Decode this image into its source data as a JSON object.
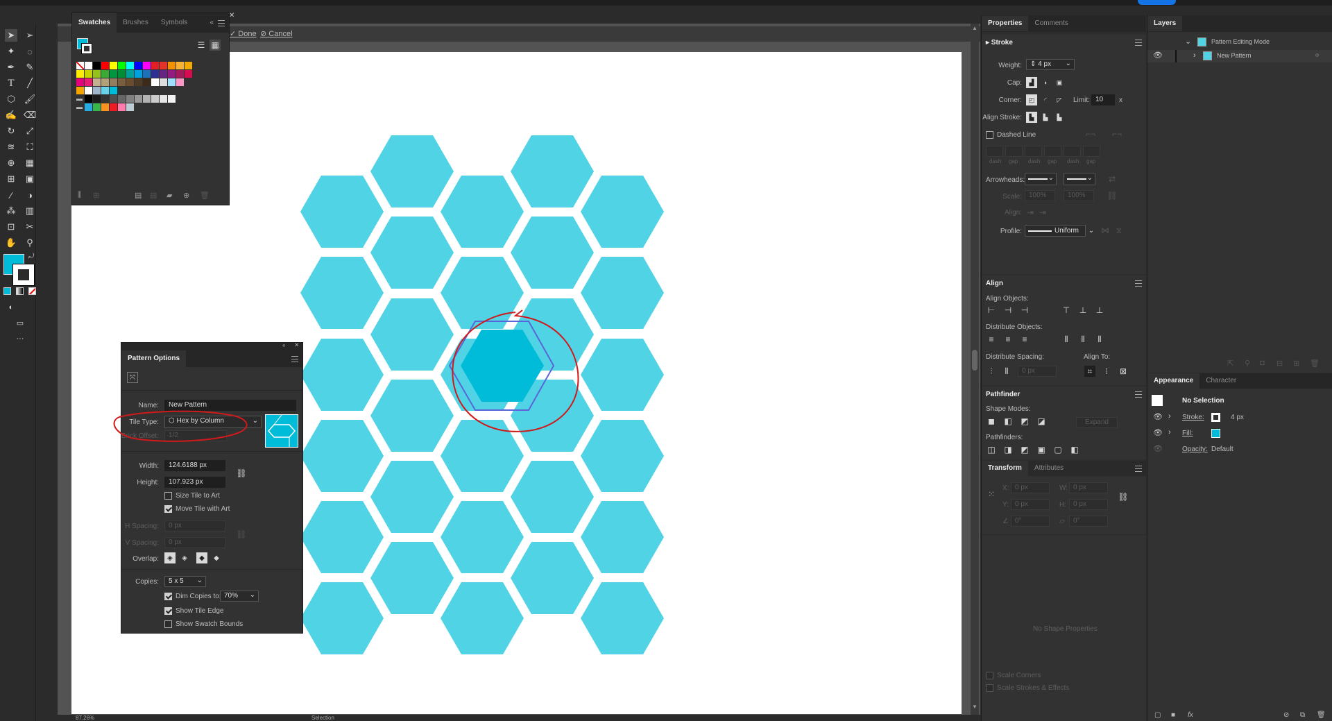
{
  "edit_bar": {
    "done": "Done",
    "cancel": "Cancel"
  },
  "swatches_panel": {
    "tabs": [
      "Swatches",
      "Brushes",
      "Symbols"
    ]
  },
  "pattern_options": {
    "title": "Pattern Options",
    "name_label": "Name:",
    "name_value": "New Pattern",
    "tile_type_label": "Tile Type:",
    "tile_type_value": "Hex by Column",
    "brick_offset_label": "Brick Offset:",
    "brick_offset_value": "1/2",
    "width_label": "Width:",
    "width_value": "124.6188 px",
    "height_label": "Height:",
    "height_value": "107.923 px",
    "size_tile_label": "Size Tile to Art",
    "move_tile_label": "Move Tile with Art",
    "h_spacing_label": "H Spacing:",
    "h_spacing_value": "0 px",
    "v_spacing_label": "V Spacing:",
    "v_spacing_value": "0 px",
    "overlap_label": "Overlap:",
    "copies_label": "Copies:",
    "copies_value": "5 x 5",
    "dim_copies_label": "Dim Copies to:",
    "dim_copies_value": "70%",
    "show_tile_edge_label": "Show Tile Edge",
    "show_swatch_bounds_label": "Show Swatch Bounds",
    "size_tile_checked": false,
    "move_tile_checked": true,
    "dim_copies_checked": true,
    "show_tile_edge_checked": true,
    "show_swatch_bounds_checked": false
  },
  "properties": {
    "tabs": [
      "Properties",
      "Comments"
    ],
    "stroke": {
      "title": "Stroke",
      "weight_label": "Weight:",
      "weight_value": "4 px",
      "cap_label": "Cap:",
      "corner_label": "Corner:",
      "limit_label": "Limit:",
      "limit_value": "10",
      "limit_unit": "x",
      "align_stroke_label": "Align Stroke:",
      "dashed_line_label": "Dashed Line",
      "dash_labels": [
        "dash",
        "gap",
        "dash",
        "gap",
        "dash",
        "gap"
      ],
      "arrowheads_label": "Arrowheads:",
      "scale_label": "Scale:",
      "scale_values": [
        "100%",
        "100%"
      ],
      "align_label": "Align:",
      "profile_label": "Profile:",
      "profile_value": "Uniform"
    },
    "align": {
      "title": "Align",
      "align_objects_label": "Align Objects:",
      "distribute_objects_label": "Distribute Objects:",
      "distribute_spacing_label": "Distribute Spacing:",
      "align_to_label": "Align To:",
      "spacing_value": "0 px"
    },
    "pathfinder": {
      "title": "Pathfinder",
      "shape_modes_label": "Shape Modes:",
      "expand_label": "Expand",
      "pathfinders_label": "Pathfinders:"
    },
    "transform": {
      "tabs": [
        "Transform",
        "Attributes"
      ],
      "x_label": "X:",
      "x_value": "0 px",
      "y_label": "Y:",
      "y_value": "0 px",
      "w_label": "W:",
      "w_value": "0 px",
      "h_label": "H:",
      "h_value": "0 px",
      "angle_value": "0°",
      "shear_value": "0°",
      "no_shape_label": "No Shape Properties",
      "scale_corners_label": "Scale Corners",
      "scale_strokes_label": "Scale Strokes & Effects"
    }
  },
  "layers": {
    "tab": "Layers",
    "items": [
      {
        "label": "Pattern Editing Mode"
      },
      {
        "label": "New Pattern"
      }
    ]
  },
  "appearance": {
    "tabs": [
      "Appearance",
      "Character"
    ],
    "title": "No Selection",
    "stroke_label": "Stroke:",
    "stroke_value": "4 px",
    "fill_label": "Fill:",
    "opacity_label": "Opacity:",
    "opacity_value": "Default"
  },
  "status_bar": {
    "zoom": "87.26%",
    "mode": "Selection"
  },
  "colors": {
    "hex_fill": "#4fd3e5",
    "hex_selected": "#00bcd8",
    "accent": "#1473e6",
    "annotation": "#d0191b",
    "canvas": "#ffffff",
    "ui_dark": "#2b2b2b",
    "panel": "#323232"
  }
}
